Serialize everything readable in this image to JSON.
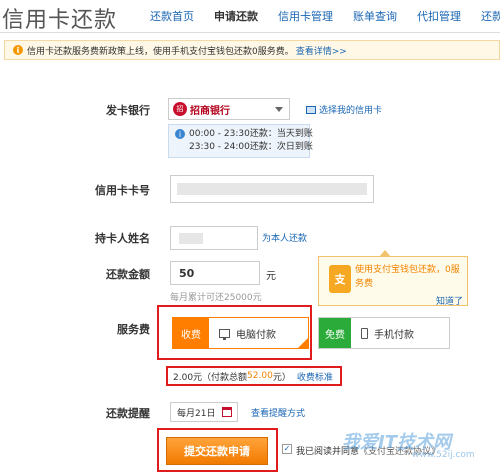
{
  "header": {
    "title": "信用卡还款",
    "nav": [
      "还款首页",
      "申请还款",
      "信用卡管理",
      "账单查询",
      "代扣管理",
      "还款记"
    ]
  },
  "notice": {
    "text": "信用卡还款服务费新政策上线，使用手机支付宝钱包还款0服务费。",
    "link": "查看详情>>"
  },
  "form": {
    "bank_label": "发卡银行",
    "bank_name": "招商银行",
    "choose_bank": "选择我的信用卡",
    "time_line1": "00:00 - 23:30还款：当天到账",
    "time_line2": "23:30 - 24:00还款：次日到账",
    "card_label": "信用卡卡号",
    "holder_label": "持卡人姓名",
    "self_pay": "为本人还款",
    "amount_label": "还款金额",
    "amount_value": "50",
    "amount_unit": "元",
    "month_total": "每月累计可还25000元",
    "fee_label": "服务费",
    "fee_charge_tag": "收费",
    "fee_charge_option": "电脑付款",
    "fee_free_tag": "免费",
    "fee_free_option": "手机付款",
    "fee_amount": "2.00元（付款总额",
    "fee_total": "52.00",
    "fee_close": "元）",
    "fee_standard": "收费标准",
    "reminder_label": "还款提醒",
    "reminder_date": "每月21日",
    "reminder_link": "查看提醒方式",
    "submit": "提交还款申请",
    "agree_text": "我已阅读并同意",
    "agree_link": "《支付宝还款协议》"
  },
  "tooltip": {
    "icon": "支",
    "text": "使用支付宝钱包还款，0服务费",
    "link": "知道了"
  },
  "watermark": {
    "main": "我爱IT技术网",
    "sub": "www.52ij.com"
  },
  "colors": {
    "accent": "#ff7e00",
    "link": "#1a66b3",
    "free": "#2bab3a",
    "highlight": "#e01b1b"
  }
}
